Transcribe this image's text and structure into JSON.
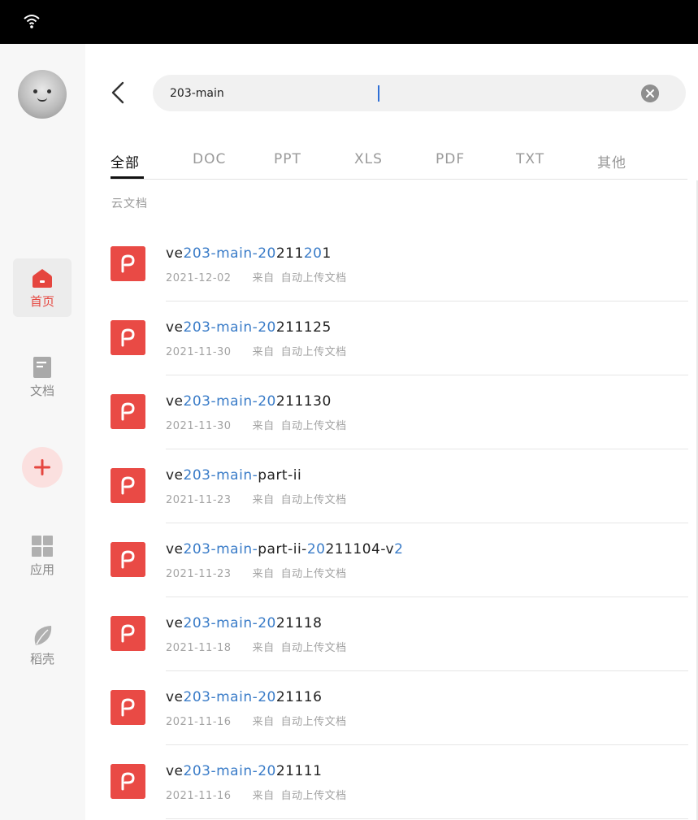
{
  "colors": {
    "accent": "#e5463f",
    "highlight": "#3a7cc8",
    "pdf_icon": "#e94a45"
  },
  "sidebar": {
    "items": [
      {
        "label": "首页",
        "icon": "home-icon",
        "active": true
      },
      {
        "label": "文档",
        "icon": "document-icon",
        "active": false
      },
      {
        "label": "应用",
        "icon": "apps-grid-icon",
        "active": false
      },
      {
        "label": "稻壳",
        "icon": "leaf-icon",
        "active": false
      }
    ],
    "add_icon": "plus-icon"
  },
  "search": {
    "value": "203-main"
  },
  "tabs": [
    "全部",
    "DOC",
    "PPT",
    "XLS",
    "PDF",
    "TXT",
    "其他"
  ],
  "section": {
    "label": "云文档"
  },
  "files": [
    {
      "name_parts": [
        "ve",
        "203-main-20",
        "211",
        "20",
        "1"
      ],
      "date": "2021-12-02",
      "from": "来自",
      "source": "自动上传文档"
    },
    {
      "name_parts": [
        "ve",
        "203-main-20",
        "211125"
      ],
      "date": "2021-11-30",
      "from": "来自",
      "source": "自动上传文档"
    },
    {
      "name_parts": [
        "ve",
        "203-main-20",
        "211130"
      ],
      "date": "2021-11-30",
      "from": "来自",
      "source": "自动上传文档"
    },
    {
      "name_parts": [
        "ve",
        "203-main-",
        "part-ii"
      ],
      "date": "2021-11-23",
      "from": "来自",
      "source": "自动上传文档"
    },
    {
      "name_parts": [
        "ve",
        "203-main-",
        "part-ii-",
        "20",
        "211104-v",
        "2"
      ],
      "date": "2021-11-23",
      "from": "来自",
      "source": "自动上传文档"
    },
    {
      "name_parts": [
        "ve",
        "203-main-20",
        "21118"
      ],
      "date": "2021-11-18",
      "from": "来自",
      "source": "自动上传文档"
    },
    {
      "name_parts": [
        "ve",
        "203-main-20",
        "21116"
      ],
      "date": "2021-11-16",
      "from": "来自",
      "source": "自动上传文档"
    },
    {
      "name_parts": [
        "ve",
        "203-main-20",
        "21111"
      ],
      "date": "2021-11-16",
      "from": "来自",
      "source": "自动上传文档"
    }
  ]
}
